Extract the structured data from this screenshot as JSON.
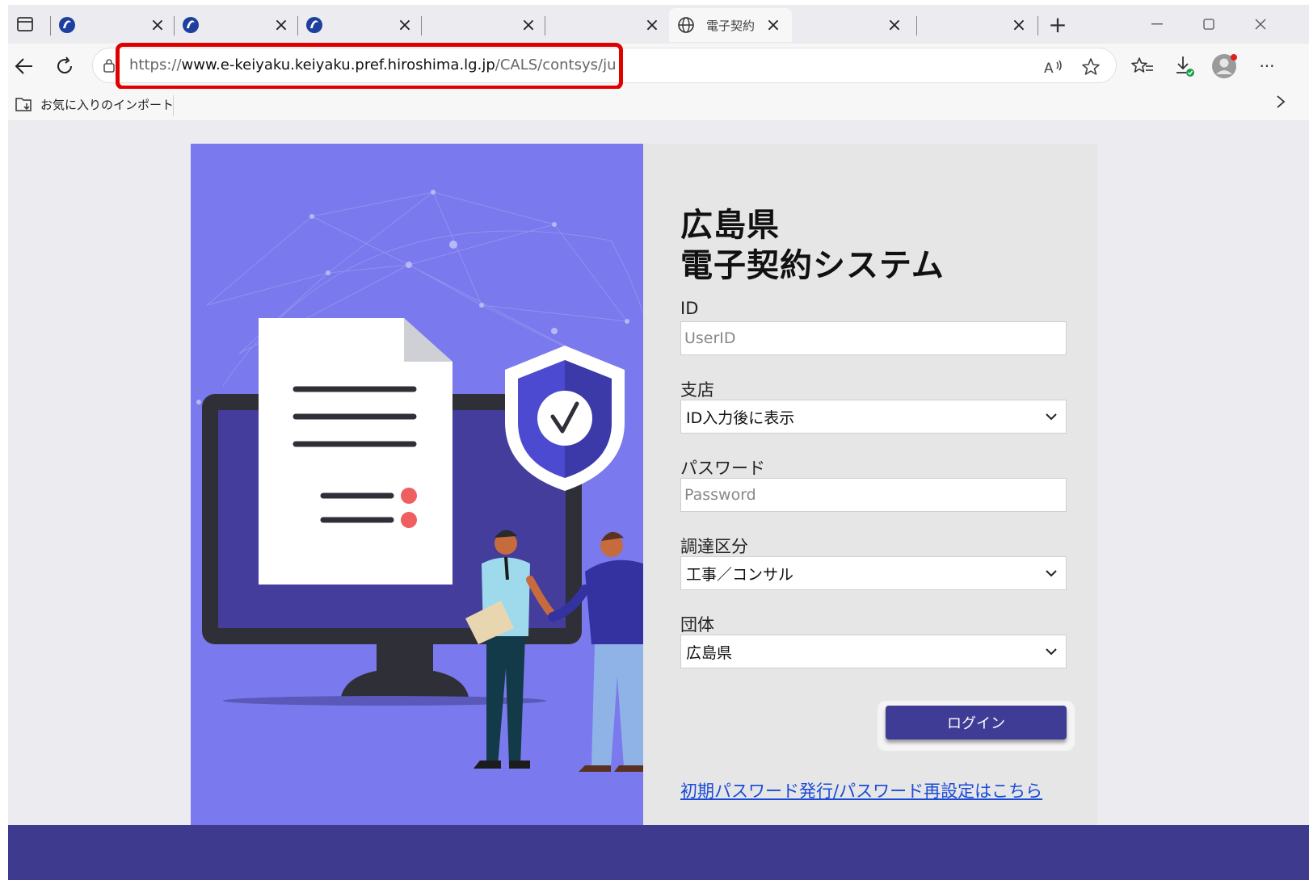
{
  "browser": {
    "tabs": [
      {
        "title": "",
        "favicon": "site-logo-icon"
      },
      {
        "title": "",
        "favicon": "site-logo-icon"
      },
      {
        "title": "",
        "favicon": "site-logo-icon"
      },
      {
        "title": "",
        "favicon": ""
      },
      {
        "title": "",
        "favicon": ""
      },
      {
        "title": "電子契約",
        "favicon": "globe-icon",
        "active": true
      },
      {
        "title": "",
        "favicon": ""
      },
      {
        "title": "",
        "favicon": ""
      }
    ],
    "new_tab_glyph": "+",
    "url_scheme": "https://",
    "url_host": "www.e-keiyaku.keiyaku.pref.hiroshima.lg.jp",
    "url_path": "/CALS/contsys/ju",
    "favorites_import_label": "お気に入りのインポート",
    "highlight_color": "#e00000"
  },
  "login": {
    "title_line1": "広島県",
    "title_line2": "電子契約システム",
    "id_label": "ID",
    "id_placeholder": "UserID",
    "branch_label": "支店",
    "branch_value": "ID入力後に表示",
    "password_label": "パスワード",
    "password_placeholder": "Password",
    "procurement_label": "調達区分",
    "procurement_value": "工事／コンサル",
    "org_label": "団体",
    "org_value": "広島県",
    "login_button": "ログイン",
    "reset_link": "初期パスワード発行/パスワード再設定はこちら"
  },
  "colors": {
    "illustration_bg": "#7a79ed",
    "button_bg": "#3f3c96",
    "footer_band": "#3e3a8e",
    "link": "#1a4ad8"
  }
}
